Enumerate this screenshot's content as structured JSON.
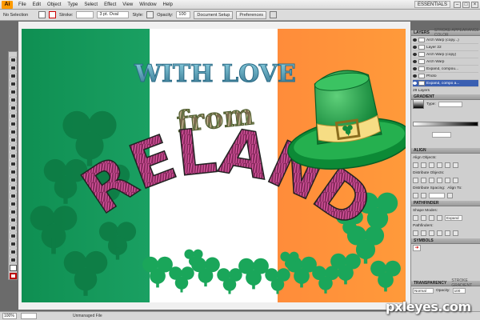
{
  "app": {
    "logo_text": "Ai",
    "menus": [
      "File",
      "Edit",
      "Object",
      "Type",
      "Select",
      "Effect",
      "View",
      "Window",
      "Help"
    ],
    "workspace": "ESSENTIALS"
  },
  "control_bar": {
    "selection_label": "No Selection",
    "stroke_label": "Stroke:",
    "brush_value": "3 pt. Oval",
    "style_label": "Style:",
    "opacity_label": "Opacity:",
    "opacity_value": "100",
    "document_setup": "Document Setup",
    "preferences": "Preferences"
  },
  "artboard": {
    "line1": "WITH LOVE",
    "line2": "from",
    "line3": "IRELAND"
  },
  "panels": {
    "layers": {
      "tab": "LAYERS",
      "tab_alt": "STROKE  APPEARANCE  COLOR",
      "items": [
        {
          "name": "Arch Warp (copy...)"
        },
        {
          "name": "Layer 22"
        },
        {
          "name": "Arch Warp (copy)"
        },
        {
          "name": "Arch Warp"
        },
        {
          "name": "Expand, compou..."
        },
        {
          "name": "Photo"
        },
        {
          "name": "Expand, compo a..."
        }
      ],
      "footer": "29 Layers"
    },
    "gradient": {
      "tab": "GRADIENT",
      "type_label": "Type:"
    },
    "align": {
      "tab": "ALIGN",
      "align_objects": "Align Objects:",
      "distribute_objects": "Distribute Objects:",
      "distribute_spacing": "Distribute Spacing:",
      "align_to": "Align To:"
    },
    "pathfinder": {
      "tab": "PATHFINDER",
      "shape_modes": "Shape Modes:",
      "expand": "Expand",
      "pathfinders": "Pathfinders:"
    },
    "symbols": {
      "tab": "SYMBOLS"
    },
    "transparency": {
      "tab": "TRANSPARENCY",
      "tab_alt": "STROKE  GRADIENT",
      "blend_mode": "Normal",
      "opacity_label": "Opacity:",
      "opacity_value": "100"
    }
  },
  "status_bar": {
    "zoom": "100%",
    "status_text": "Unmanaged File"
  },
  "watermark": "pxleyes.com",
  "colors": {
    "flag_green": "#169b62",
    "flag_white": "#ffffff",
    "flag_orange": "#ff883e",
    "hat_green": "#1aa24a",
    "hat_band": "#f4d97a",
    "title_teal": "#3e8ea8"
  }
}
